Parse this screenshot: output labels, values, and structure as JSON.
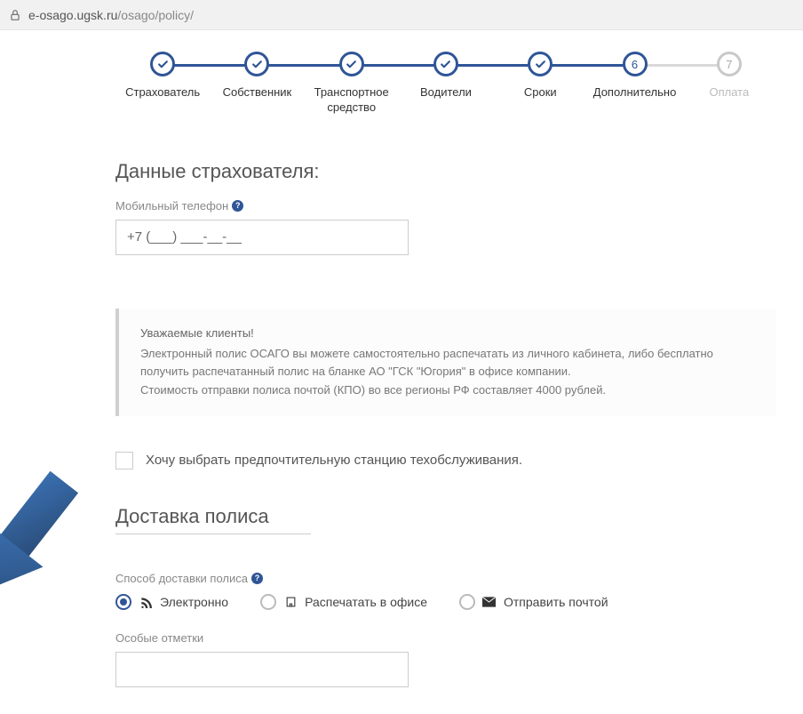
{
  "url": {
    "host": "e-osago.ugsk.ru",
    "path": "/osago/policy/"
  },
  "stepper": [
    {
      "label": "Страхователь",
      "state": "done"
    },
    {
      "label": "Собственник",
      "state": "done"
    },
    {
      "label": "Транспортное средство",
      "state": "done"
    },
    {
      "label": "Водители",
      "state": "done"
    },
    {
      "label": "Сроки",
      "state": "done"
    },
    {
      "label": "Дополнительно",
      "state": "current",
      "num": "6"
    },
    {
      "label": "Оплата",
      "state": "pending",
      "num": "7"
    }
  ],
  "insurer": {
    "heading": "Данные страхователя:",
    "phone_label": "Мобильный телефон",
    "phone_value": "+7 (___) ___-__-__"
  },
  "info": {
    "title": "Уважаемые клиенты!",
    "line1": "Электронный полис ОСАГО вы можете самостоятельно распечатать из личного кабинета, либо бесплатно получить распечатанный полис на бланке АО \"ГСК \"Югория\" в офисе компании.",
    "line2": "Стоимость отправки полиса почтой (КПО) во все регионы РФ составляет 4000 рублей."
  },
  "service_checkbox": "Хочу выбрать предпочтительную станцию техобслуживания.",
  "delivery": {
    "heading": "Доставка полиса",
    "method_label": "Способ доставки полиса",
    "options": [
      {
        "label": "Электронно",
        "checked": true
      },
      {
        "label": "Распечатать в офисе",
        "checked": false
      },
      {
        "label": "Отправить почтой",
        "checked": false
      }
    ],
    "notes_label": "Особые отметки",
    "notes_value": ""
  }
}
